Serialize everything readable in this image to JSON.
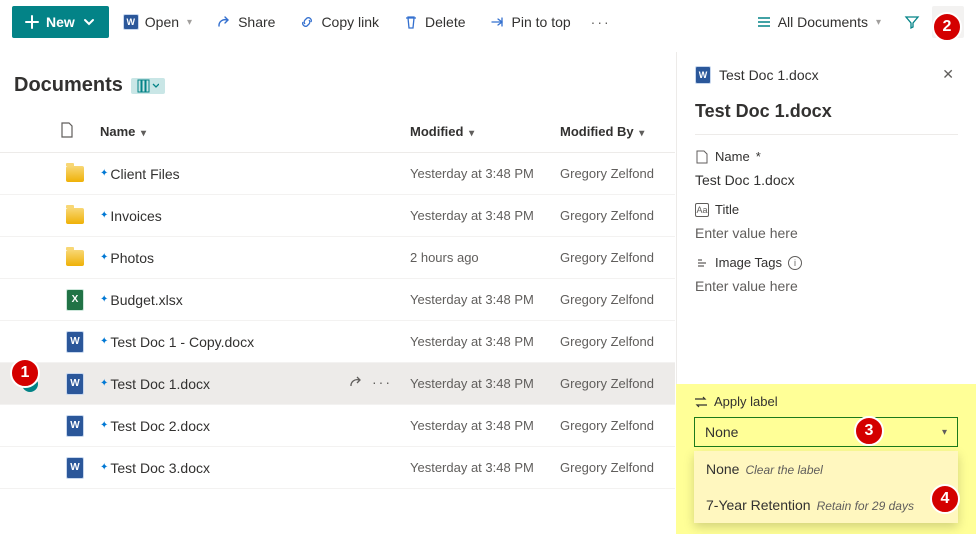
{
  "toolbar": {
    "new_label": "New",
    "open_label": "Open",
    "share_label": "Share",
    "copylink_label": "Copy link",
    "delete_label": "Delete",
    "pin_label": "Pin to top",
    "alldocs_label": "All Documents"
  },
  "page": {
    "title": "Documents"
  },
  "columns": {
    "name": "Name",
    "modified": "Modified",
    "modified_by": "Modified By"
  },
  "rows": [
    {
      "icon": "folder",
      "name": "Client Files",
      "modified": "Yesterday at 3:48 PM",
      "modified_by": "Gregory Zelfond"
    },
    {
      "icon": "folder",
      "name": "Invoices",
      "modified": "Yesterday at 3:48 PM",
      "modified_by": "Gregory Zelfond"
    },
    {
      "icon": "folder",
      "name": "Photos",
      "modified": "2 hours ago",
      "modified_by": "Gregory Zelfond"
    },
    {
      "icon": "excel",
      "name": "Budget.xlsx",
      "modified": "Yesterday at 3:48 PM",
      "modified_by": "Gregory Zelfond"
    },
    {
      "icon": "word",
      "name": "Test Doc 1 - Copy.docx",
      "modified": "Yesterday at 3:48 PM",
      "modified_by": "Gregory Zelfond"
    },
    {
      "icon": "word",
      "name": "Test Doc 1.docx",
      "modified": "Yesterday at 3:48 PM",
      "modified_by": "Gregory Zelfond",
      "selected": true
    },
    {
      "icon": "word",
      "name": "Test Doc 2.docx",
      "modified": "Yesterday at 3:48 PM",
      "modified_by": "Gregory Zelfond"
    },
    {
      "icon": "word",
      "name": "Test Doc 3.docx",
      "modified": "Yesterday at 3:48 PM",
      "modified_by": "Gregory Zelfond"
    }
  ],
  "pane": {
    "file_name_header": "Test Doc 1.docx",
    "title": "Test Doc 1.docx",
    "name_label": "Name",
    "name_value": "Test Doc 1.docx",
    "title_label": "Title",
    "title_placeholder": "Enter value here",
    "tags_label": "Image Tags",
    "tags_placeholder": "Enter value here",
    "apply_label": "Apply label",
    "select_value": "None",
    "options": [
      {
        "label": "None",
        "sub": "Clear the label"
      },
      {
        "label": "7-Year Retention",
        "sub": "Retain for 29 days"
      }
    ]
  },
  "callouts": {
    "1": "1",
    "2": "2",
    "3": "3",
    "4": "4"
  }
}
